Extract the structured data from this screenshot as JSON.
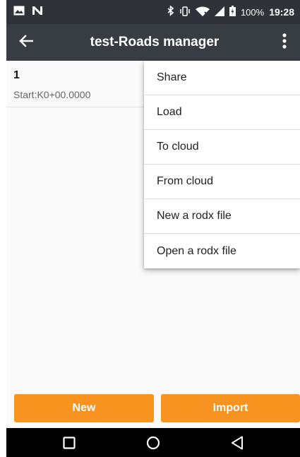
{
  "status_bar": {
    "battery": "100%",
    "time": "19:28"
  },
  "app_bar": {
    "title": "test-Roads manager"
  },
  "roads": [
    {
      "name": "1",
      "start": "Start:K0+00.0000"
    }
  ],
  "menu": {
    "items": [
      "Share",
      "Load",
      "To cloud",
      "From cloud",
      "New a rodx file",
      "Open a rodx file"
    ]
  },
  "buttons": {
    "new_label": "New",
    "import_label": "Import"
  },
  "colors": {
    "status_bar": "#2f3339",
    "app_bar": "#383d44",
    "accent": "#f7931e",
    "nav_bar": "#000000"
  },
  "icons": {
    "status_left": [
      "image-icon",
      "n-notification-icon"
    ],
    "status_right": [
      "bluetooth-icon",
      "vibrate-icon",
      "wifi-icon",
      "signal-icon",
      "battery-icon"
    ],
    "app_bar": [
      "back-arrow-icon",
      "overflow-menu-icon"
    ],
    "nav_bar": [
      "recents-icon",
      "home-icon",
      "back-icon"
    ]
  }
}
